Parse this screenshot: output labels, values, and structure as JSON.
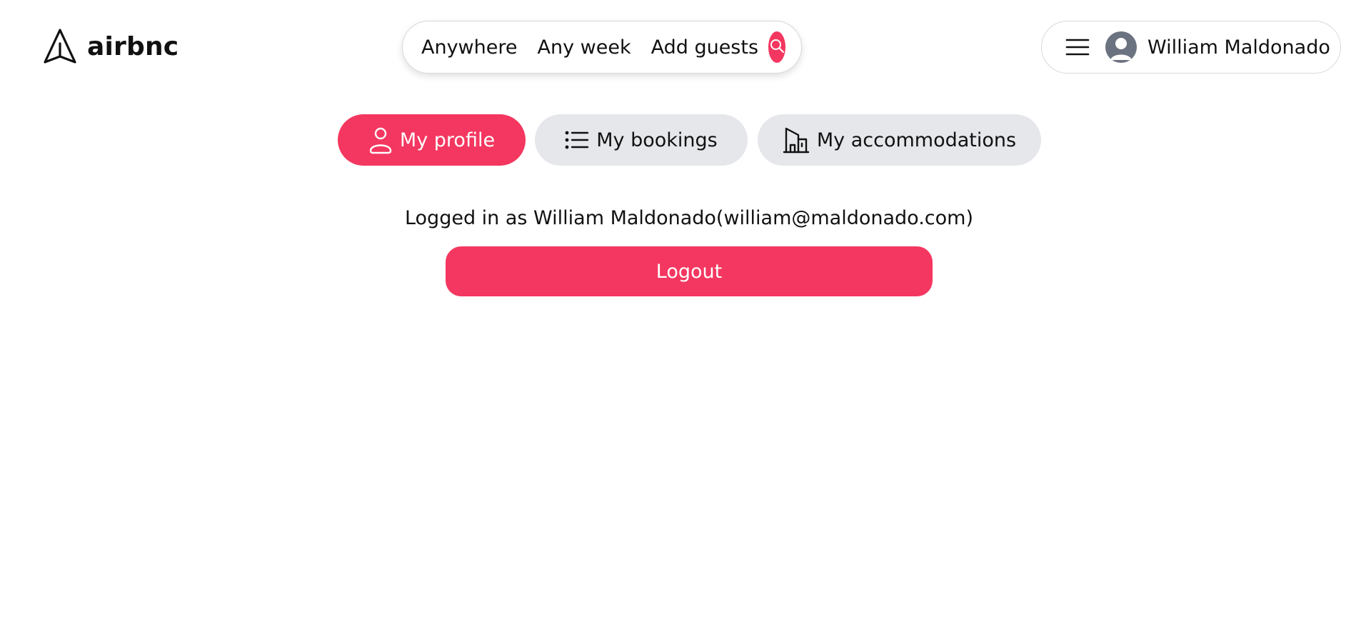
{
  "colors": {
    "accent": "#f43760",
    "tab_inactive_bg": "#e5e7eb",
    "avatar_bg": "#6b7280"
  },
  "header": {
    "logo_icon": "paper-plane-icon",
    "logo_text": "airbnc",
    "search": {
      "location": "Anywhere",
      "dates": "Any week",
      "guests": "Add guests",
      "search_icon": "search-icon"
    },
    "user_menu": {
      "menu_icon": "hamburger-icon",
      "avatar_icon": "user-avatar-icon",
      "user_name": "William Maldonado"
    }
  },
  "tabs": [
    {
      "label": "My profile",
      "icon": "user-icon",
      "active": true
    },
    {
      "label": "My bookings",
      "icon": "list-icon",
      "active": false
    },
    {
      "label": "My accommodations",
      "icon": "building-icon",
      "active": false
    }
  ],
  "profile": {
    "login_status": "Logged in as William Maldonado(william@maldonado.com)",
    "logout_label": "Logout"
  }
}
